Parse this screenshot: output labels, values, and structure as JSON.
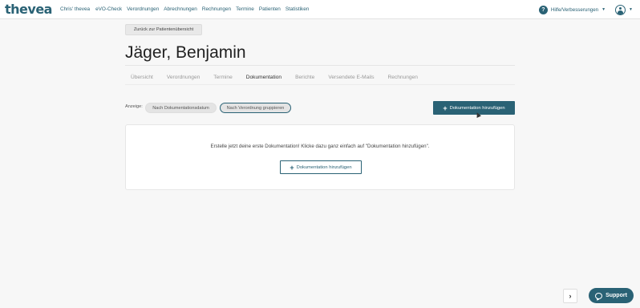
{
  "app": {
    "logo": "thevea"
  },
  "nav": [
    {
      "label": "Chris' thevea"
    },
    {
      "label": "eVO-Check"
    },
    {
      "label": "Verordnungen"
    },
    {
      "label": "Abrechnungen"
    },
    {
      "label": "Rechnungen"
    },
    {
      "label": "Termine"
    },
    {
      "label": "Patienten"
    },
    {
      "label": "Statistiken"
    }
  ],
  "header_right": {
    "help_icon": "?",
    "help_label": "Hilfe/Verbesserungen",
    "caret": "▼"
  },
  "page": {
    "back_button": "Zurück zur Patientenübersicht",
    "patient_name": "Jäger, Benjamin",
    "tabs": [
      {
        "label": "Übersicht",
        "active": false
      },
      {
        "label": "Verordnungen",
        "active": false
      },
      {
        "label": "Termine",
        "active": false
      },
      {
        "label": "Dokumentation",
        "active": true
      },
      {
        "label": "Berichte",
        "active": false
      },
      {
        "label": "Versendete E-Mails",
        "active": false
      },
      {
        "label": "Rechnungen",
        "active": false
      }
    ],
    "view_label": "Anzeige:",
    "view_options": [
      {
        "label": "Nach Dokumentationsdatum",
        "selected": false
      },
      {
        "label": "Nach Verordnung gruppieren",
        "selected": true
      }
    ],
    "add_button": "Dokumentation hinzufügen",
    "plus_icon": "+",
    "empty_state": {
      "text": "Erstelle jetzt deine erste Dokumentation! Klicke dazu ganz einfach auf \"Dokumentation hinzufügen\".",
      "button": "Dokumentation hinzufügen"
    }
  },
  "footer": {
    "expand_icon": "›",
    "support_label": "Support"
  },
  "colors": {
    "accent": "#2a6275",
    "background": "#f7f7f7"
  }
}
